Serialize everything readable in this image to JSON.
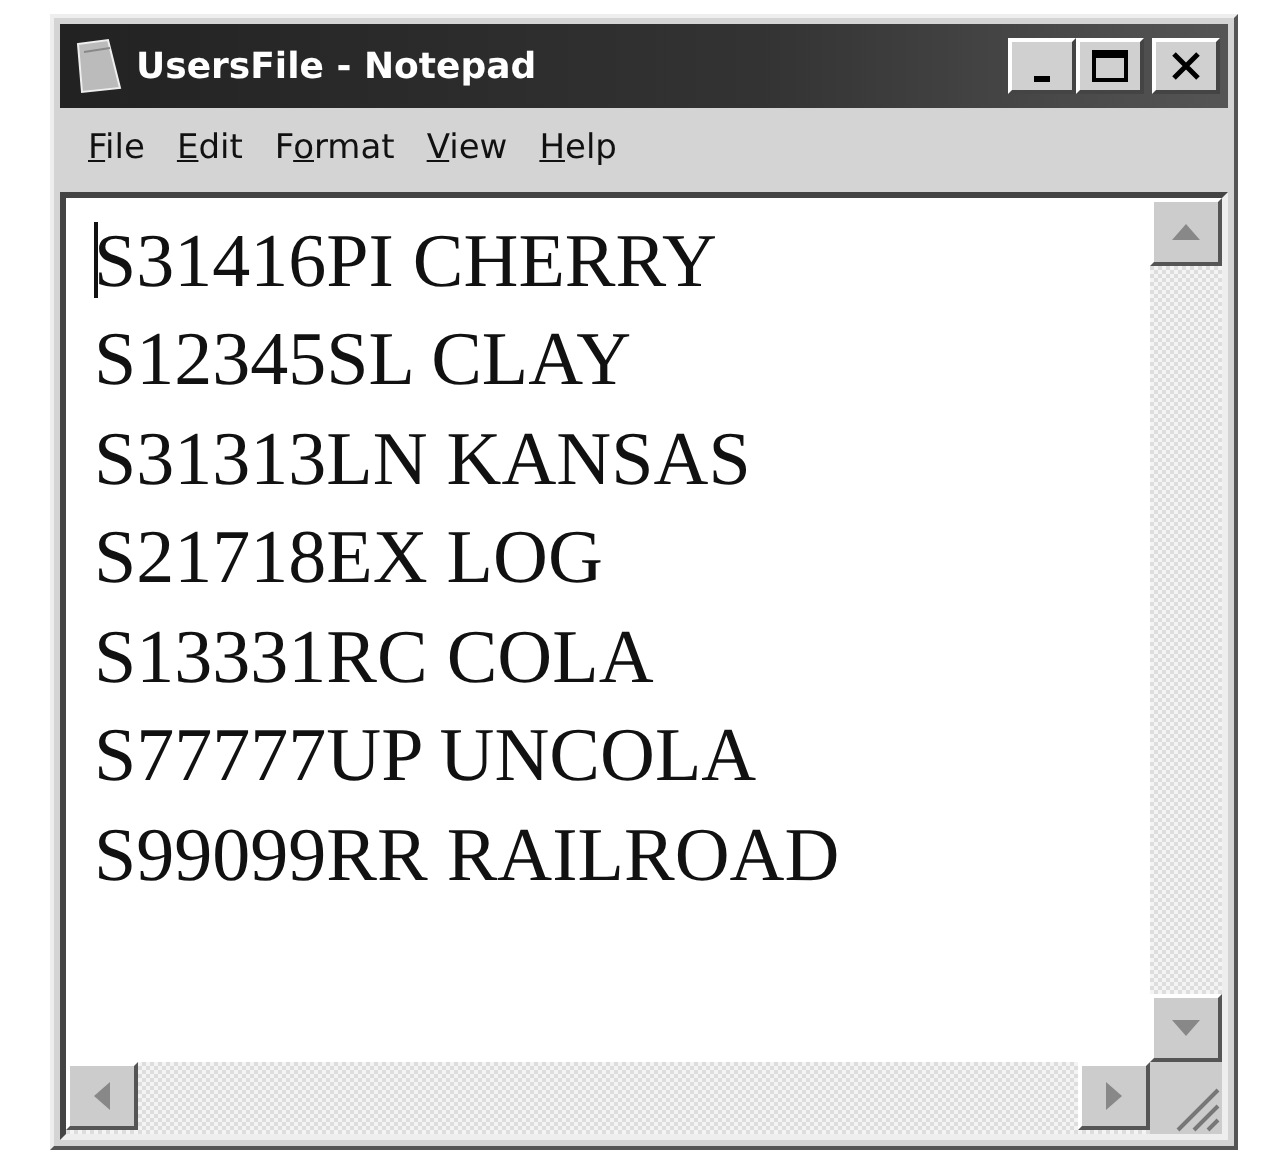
{
  "window": {
    "title": "UsersFile - Notepad"
  },
  "menu": [
    {
      "label_parts": [
        {
          "text": "F",
          "underlined": true
        },
        {
          "text": "ile",
          "underlined": false
        }
      ]
    },
    {
      "label_parts": [
        {
          "text": "E",
          "underlined": true
        },
        {
          "text": "dit",
          "underlined": false
        }
      ]
    },
    {
      "label_parts": [
        {
          "text": "F",
          "underlined": false
        },
        {
          "text": "o",
          "underlined": true
        },
        {
          "text": "rmat",
          "underlined": false
        }
      ]
    },
    {
      "label_parts": [
        {
          "text": "V",
          "underlined": true
        },
        {
          "text": "iew",
          "underlined": false
        }
      ]
    },
    {
      "label_parts": [
        {
          "text": "H",
          "underlined": true
        },
        {
          "text": "elp",
          "underlined": false
        }
      ]
    }
  ],
  "editor": {
    "lines": [
      "S31416PI CHERRY",
      "S12345SL CLAY",
      "S31313LN KANSAS",
      "S21718EX LOG",
      "S13331RC COLA",
      "S77777UP UNCOLA",
      "S99099RR RAILROAD"
    ],
    "caret": true
  }
}
